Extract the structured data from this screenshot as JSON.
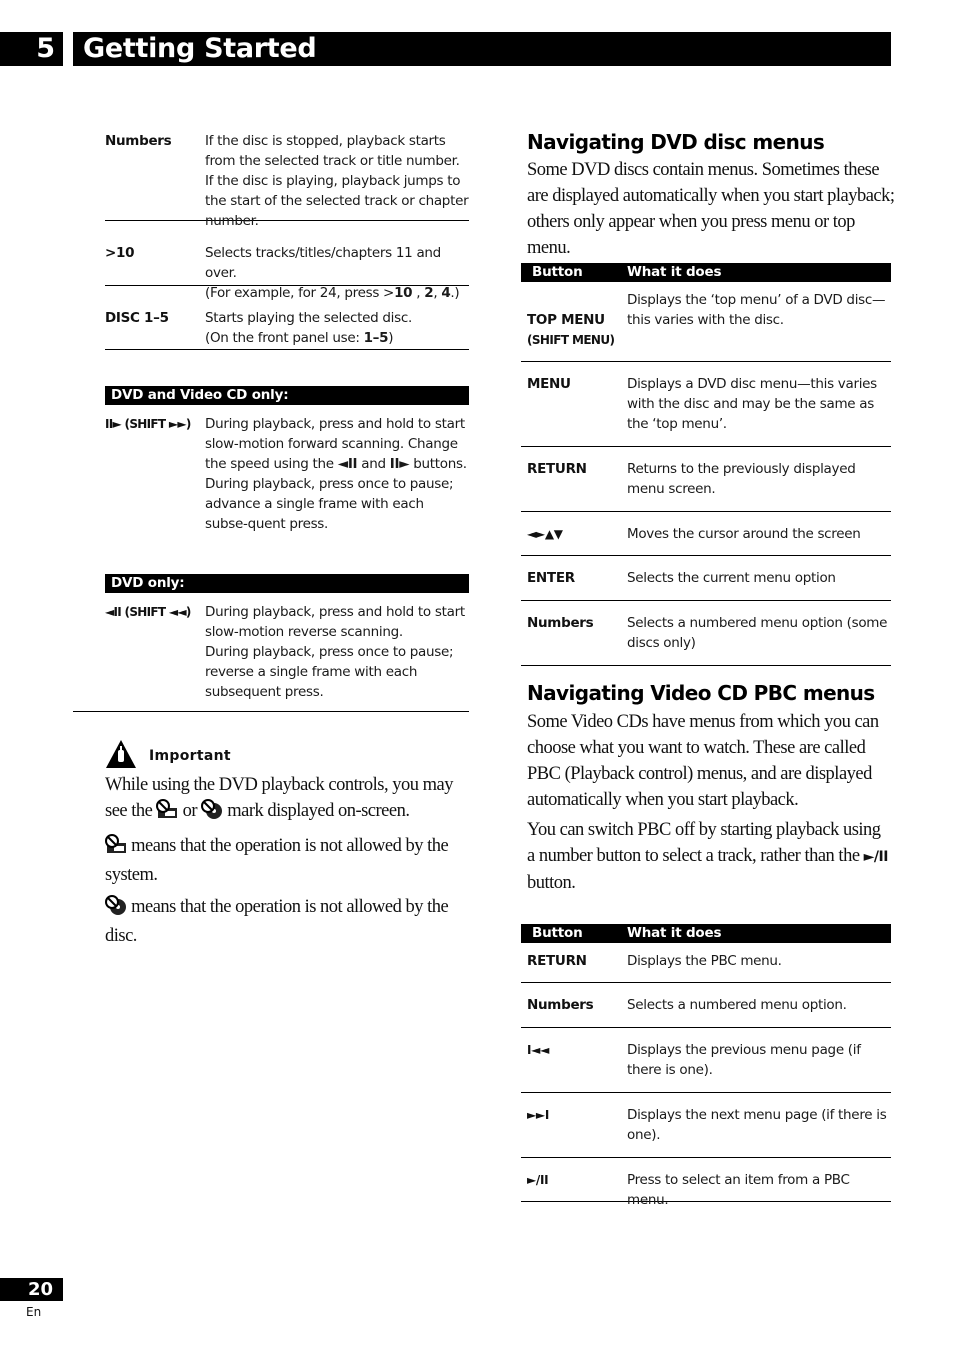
{
  "header": {
    "chapter_number": "5",
    "chapter_title": "Getting Started"
  },
  "left": {
    "table1": [
      {
        "key": "Numbers",
        "desc": "If the disc is stopped, playback starts from the selected track or title number. If the disc is playing, playback jumps to the start of the selected track or chapter number."
      },
      {
        "key": ">10",
        "desc_line1": "Selects tracks/titles/chapters 11 and over.",
        "desc_line2_pre": "(For example, for 24, press >",
        "desc_b1": "10",
        "desc_mid1": " , ",
        "desc_b2": "2",
        "desc_mid2": ", ",
        "desc_b3": "4",
        "desc_end": ".)"
      },
      {
        "key": "DISC 1–5",
        "desc_line1": "Starts playing the selected disc.",
        "desc_line2_pre": "(On the front panel use: ",
        "desc_b": "1–5",
        "desc_end": ")"
      }
    ],
    "dvd_vcd_section": {
      "title": "DVD and Video CD only:",
      "key": "II► (SHIFT ►►)",
      "desc_pre": "During playback, press and hold to start slow-motion forward scanning. Change the speed using the ",
      "desc_b1": "◄II",
      "desc_mid": " and ",
      "desc_b2": "II►",
      "desc_post": " buttons. During playback, press once to pause; advance a single frame with each subse-quent press."
    },
    "dvd_only_section": {
      "title": "DVD only:",
      "key": "◄II (SHIFT ◄◄)",
      "desc_line1": "During playback, press and hold to start slow-motion reverse scanning.",
      "desc_line2": "During playback, press once to pause; reverse a single frame with each subsequent press."
    },
    "important": {
      "label": "Important",
      "icon": "warning-hand-icon",
      "p1_pre": "While using the DVD playback controls, you may see the",
      "p1_or": "or",
      "p1_post": "mark displayed on-screen.",
      "p2": "means that the operation is not allowed by the system.",
      "p3": "means that the operation is not allowed by the disc."
    }
  },
  "right": {
    "dvd_menus": {
      "heading": "Navigating DVD disc menus",
      "intro": "Some DVD discs contain menus. Sometimes these are displayed automatically when you start playback; others only appear when you press menu or top menu.",
      "col_button": "Button",
      "col_what": "What it does",
      "rows": [
        {
          "key": "TOP MENU",
          "sub": "(SHIFT MENU)",
          "desc": "Displays the ‘top menu’ of a DVD disc—this varies with the disc."
        },
        {
          "key": "MENU",
          "desc": "Displays a DVD disc menu—this varies with the disc and may be the same as the ‘top menu’."
        },
        {
          "key": "RETURN",
          "desc": "Returns to the previously displayed menu screen."
        },
        {
          "key": "◄►▲▼",
          "desc": "Moves the cursor around the screen"
        },
        {
          "key": "ENTER",
          "desc": "Selects the current menu option"
        },
        {
          "key": "Numbers",
          "desc": "Selects a numbered menu option (some discs only)"
        }
      ]
    },
    "pbc_menus": {
      "heading": "Navigating Video CD PBC menus",
      "intro1": "Some Video CDs have menus from which you can choose what you want to watch. These are called PBC (Playback control) menus, and are displayed automatically when you start playback.",
      "intro2_pre": "You can switch PBC off by starting playback using a number button to select a track, rather than the",
      "intro2_btn": "►/II",
      "intro2_post": "button.",
      "col_button": "Button",
      "col_what": "What it does",
      "rows": [
        {
          "key": "RETURN",
          "desc": "Displays the PBC menu."
        },
        {
          "key": "Numbers",
          "desc": "Selects a numbered menu option."
        },
        {
          "key": "I◄◄",
          "desc": "Displays the previous menu page (if there is one)."
        },
        {
          "key": "►►I",
          "desc": "Displays the next menu page (if there is one)."
        },
        {
          "key": "►/II",
          "desc": "Press to select an item from a PBC menu."
        }
      ]
    }
  },
  "footer": {
    "page_number": "20",
    "language": "En"
  }
}
